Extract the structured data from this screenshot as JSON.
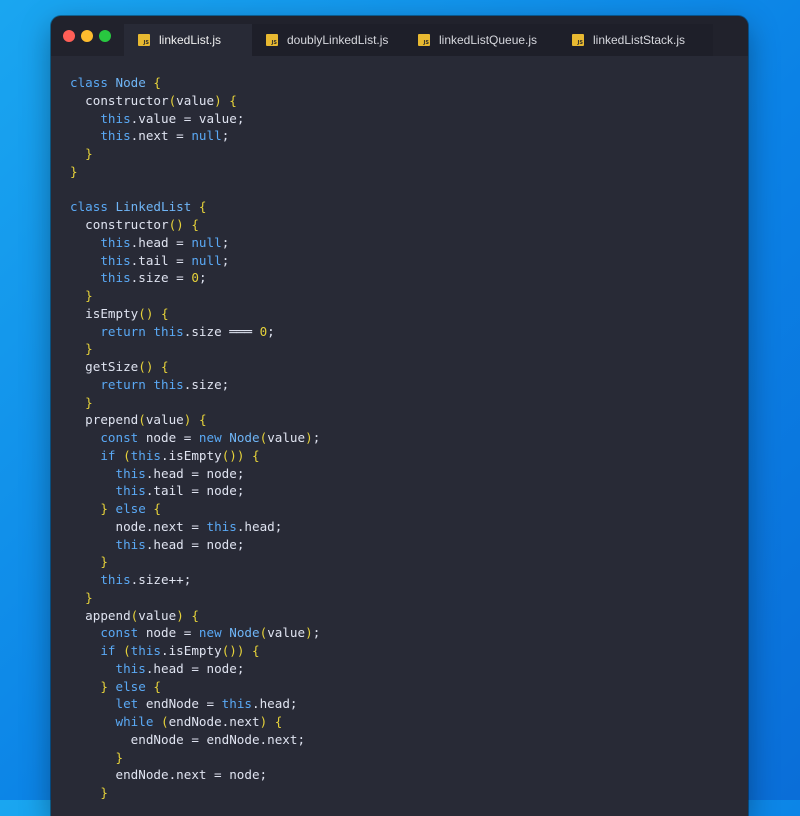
{
  "tabs": [
    {
      "label": "linkedList.js",
      "active": true
    },
    {
      "label": "doublyLinkedList.js",
      "active": false
    },
    {
      "label": "linkedListQueue.js",
      "active": false
    },
    {
      "label": "linkedListStack.js",
      "active": false
    }
  ],
  "colors": {
    "background": "#1294ec",
    "editor": "#282a36",
    "keyword": "#5aa9f5",
    "bracket": "#e6d23a",
    "text": "#dfe3f0"
  },
  "code_lines": [
    [
      [
        "kw",
        "class "
      ],
      [
        "cl",
        "Node "
      ],
      [
        "br",
        "{"
      ]
    ],
    [
      [
        "tx",
        "  constructor"
      ],
      [
        "br",
        "("
      ],
      [
        "tx",
        "value"
      ],
      [
        "br",
        ")"
      ],
      [
        "tx",
        " "
      ],
      [
        "br",
        "{"
      ]
    ],
    [
      [
        "kw",
        "    this"
      ],
      [
        "tx",
        ".value = value;"
      ]
    ],
    [
      [
        "kw",
        "    this"
      ],
      [
        "tx",
        ".next = "
      ],
      [
        "kw",
        "null"
      ],
      [
        "tx",
        ";"
      ]
    ],
    [
      [
        "br",
        "  }"
      ]
    ],
    [
      [
        "br",
        "}"
      ]
    ],
    [
      [
        "tx",
        ""
      ]
    ],
    [
      [
        "kw",
        "class "
      ],
      [
        "cl",
        "LinkedList "
      ],
      [
        "br",
        "{"
      ]
    ],
    [
      [
        "tx",
        "  constructor"
      ],
      [
        "br",
        "()"
      ],
      [
        "tx",
        " "
      ],
      [
        "br",
        "{"
      ]
    ],
    [
      [
        "kw",
        "    this"
      ],
      [
        "tx",
        ".head = "
      ],
      [
        "kw",
        "null"
      ],
      [
        "tx",
        ";"
      ]
    ],
    [
      [
        "kw",
        "    this"
      ],
      [
        "tx",
        ".tail = "
      ],
      [
        "kw",
        "null"
      ],
      [
        "tx",
        ";"
      ]
    ],
    [
      [
        "kw",
        "    this"
      ],
      [
        "tx",
        ".size = "
      ],
      [
        "nm",
        "0"
      ],
      [
        "tx",
        ";"
      ]
    ],
    [
      [
        "br",
        "  }"
      ]
    ],
    [
      [
        "tx",
        "  isEmpty"
      ],
      [
        "br",
        "()"
      ],
      [
        "tx",
        " "
      ],
      [
        "br",
        "{"
      ]
    ],
    [
      [
        "kw",
        "    return this"
      ],
      [
        "tx",
        ".size ═══ "
      ],
      [
        "nm",
        "0"
      ],
      [
        "tx",
        ";"
      ]
    ],
    [
      [
        "br",
        "  }"
      ]
    ],
    [
      [
        "tx",
        "  getSize"
      ],
      [
        "br",
        "()"
      ],
      [
        "tx",
        " "
      ],
      [
        "br",
        "{"
      ]
    ],
    [
      [
        "kw",
        "    return this"
      ],
      [
        "tx",
        ".size;"
      ]
    ],
    [
      [
        "br",
        "  }"
      ]
    ],
    [
      [
        "tx",
        "  prepend"
      ],
      [
        "br",
        "("
      ],
      [
        "tx",
        "value"
      ],
      [
        "br",
        ")"
      ],
      [
        "tx",
        " "
      ],
      [
        "br",
        "{"
      ]
    ],
    [
      [
        "kw",
        "    const "
      ],
      [
        "tx",
        "node = "
      ],
      [
        "kw",
        "new "
      ],
      [
        "cl",
        "Node"
      ],
      [
        "br",
        "("
      ],
      [
        "tx",
        "value"
      ],
      [
        "br",
        ")"
      ],
      [
        "tx",
        ";"
      ]
    ],
    [
      [
        "kw",
        "    if "
      ],
      [
        "br",
        "("
      ],
      [
        "kw",
        "this"
      ],
      [
        "tx",
        ".isEmpty"
      ],
      [
        "br",
        "())"
      ],
      [
        "tx",
        " "
      ],
      [
        "br",
        "{"
      ]
    ],
    [
      [
        "kw",
        "      this"
      ],
      [
        "tx",
        ".head = node;"
      ]
    ],
    [
      [
        "kw",
        "      this"
      ],
      [
        "tx",
        ".tail = node;"
      ]
    ],
    [
      [
        "br",
        "    } "
      ],
      [
        "kw",
        "else "
      ],
      [
        "br",
        "{"
      ]
    ],
    [
      [
        "tx",
        "      node.next = "
      ],
      [
        "kw",
        "this"
      ],
      [
        "tx",
        ".head;"
      ]
    ],
    [
      [
        "kw",
        "      this"
      ],
      [
        "tx",
        ".head = node;"
      ]
    ],
    [
      [
        "br",
        "    }"
      ]
    ],
    [
      [
        "kw",
        "    this"
      ],
      [
        "tx",
        ".size++;"
      ]
    ],
    [
      [
        "br",
        "  }"
      ]
    ],
    [
      [
        "tx",
        "  append"
      ],
      [
        "br",
        "("
      ],
      [
        "tx",
        "value"
      ],
      [
        "br",
        ")"
      ],
      [
        "tx",
        " "
      ],
      [
        "br",
        "{"
      ]
    ],
    [
      [
        "kw",
        "    const "
      ],
      [
        "tx",
        "node = "
      ],
      [
        "kw",
        "new "
      ],
      [
        "cl",
        "Node"
      ],
      [
        "br",
        "("
      ],
      [
        "tx",
        "value"
      ],
      [
        "br",
        ")"
      ],
      [
        "tx",
        ";"
      ]
    ],
    [
      [
        "kw",
        "    if "
      ],
      [
        "br",
        "("
      ],
      [
        "kw",
        "this"
      ],
      [
        "tx",
        ".isEmpty"
      ],
      [
        "br",
        "())"
      ],
      [
        "tx",
        " "
      ],
      [
        "br",
        "{"
      ]
    ],
    [
      [
        "kw",
        "      this"
      ],
      [
        "tx",
        ".head = node;"
      ]
    ],
    [
      [
        "br",
        "    } "
      ],
      [
        "kw",
        "else "
      ],
      [
        "br",
        "{"
      ]
    ],
    [
      [
        "kw",
        "      let "
      ],
      [
        "tx",
        "endNode = "
      ],
      [
        "kw",
        "this"
      ],
      [
        "tx",
        ".head;"
      ]
    ],
    [
      [
        "kw",
        "      while "
      ],
      [
        "br",
        "("
      ],
      [
        "tx",
        "endNode.next"
      ],
      [
        "br",
        ")"
      ],
      [
        "tx",
        " "
      ],
      [
        "br",
        "{"
      ]
    ],
    [
      [
        "tx",
        "        endNode = endNode.next;"
      ]
    ],
    [
      [
        "br",
        "      }"
      ]
    ],
    [
      [
        "tx",
        "      endNode.next = node;"
      ]
    ],
    [
      [
        "br",
        "    }"
      ]
    ]
  ]
}
